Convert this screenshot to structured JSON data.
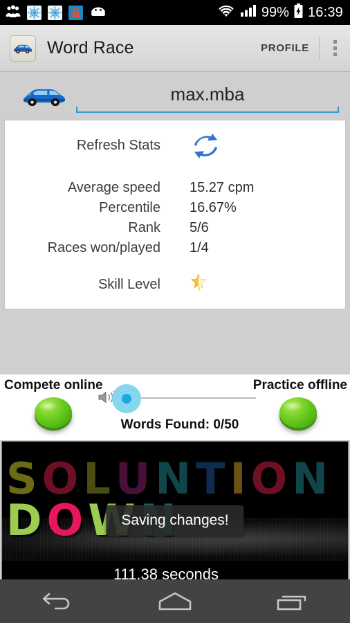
{
  "status_bar": {
    "time": "16:39",
    "battery_percent": "99%",
    "left_icons": [
      "people-icon",
      "sync-settings-icon",
      "sync-settings-icon-2",
      "lock-icon",
      "android-head-icon"
    ],
    "right_icons": [
      "wifi-icon",
      "cell-signal-icon",
      "battery-charging-icon"
    ]
  },
  "action_bar": {
    "app_icon": "car-app-icon",
    "title": "Word Race",
    "profile_label": "PROFILE",
    "overflow_label": "overflow-menu"
  },
  "user_bar": {
    "avatar_icon": "blue-car-icon",
    "username": "max.mba"
  },
  "stats": {
    "refresh_label": "Refresh Stats",
    "refresh_icon": "refresh-arrows-icon",
    "rows": [
      {
        "label": "Average speed",
        "value": "15.27 cpm"
      },
      {
        "label": "Percentile",
        "value": "16.67%"
      },
      {
        "label": "Rank",
        "value": "5/6"
      },
      {
        "label": "Races won/played",
        "value": "1/4"
      }
    ],
    "skill_label": "Skill Level",
    "skill_icon": "half-star-icon"
  },
  "compete": {
    "online_label": "Compete online",
    "offline_label": "Practice offline",
    "online_button": "compete-online-button",
    "offline_button": "practice-offline-button",
    "volume_icon": "speaker-volume-icon",
    "volume_value": 0,
    "words_found": "Words Found: 0/50"
  },
  "game": {
    "row1": [
      {
        "char": "S",
        "color": "#6b6b14"
      },
      {
        "char": "O",
        "color": "#6e1024"
      },
      {
        "char": "L",
        "color": "#4a4f10"
      },
      {
        "char": "U",
        "color": "#491037"
      },
      {
        "char": "N",
        "color": "#10454c"
      },
      {
        "char": "T",
        "color": "#0f2b4e"
      },
      {
        "char": "I",
        "color": "#6a5212"
      },
      {
        "char": "O",
        "color": "#6e1024"
      },
      {
        "char": "N",
        "color": "#10454c"
      }
    ],
    "row2": [
      {
        "char": "D",
        "color": "#9ccc52"
      },
      {
        "char": "O",
        "color": "#e8175d"
      },
      {
        "char": "W",
        "color": "#9ccc52"
      },
      {
        "char": "N",
        "color": "#1a6e74"
      }
    ],
    "toast_message": "Saving changes!",
    "timer": "111.38 seconds"
  },
  "nav_bar": {
    "back": "back-button",
    "home": "home-button",
    "recents": "recents-button"
  },
  "colors": {
    "accent_blue": "#2f9ad0",
    "slider_halo": "#87d6f0",
    "button_green": "#69cc1f",
    "page_bg": "#cfcfcf"
  }
}
